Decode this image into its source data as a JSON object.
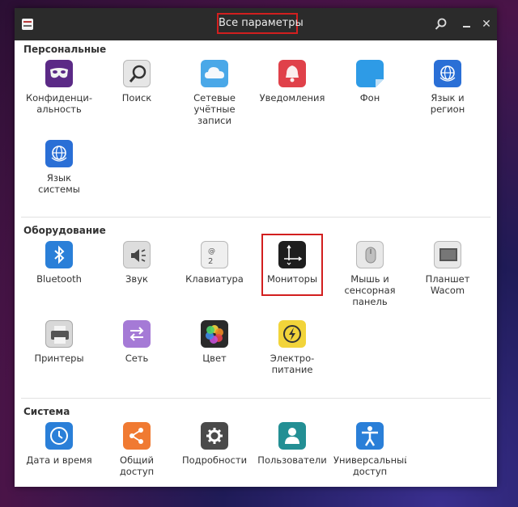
{
  "window": {
    "title": "Все параметры"
  },
  "sections": {
    "personal": "Персональные",
    "hardware": "Оборудование",
    "system": "Система"
  },
  "items": {
    "privacy": "Конфиденци-\nальность",
    "search": "Поиск",
    "online_accounts": "Сетевые\nучётные\nзаписи",
    "notifications": "Уведомления",
    "background": "Фон",
    "language_region": "Язык и\nрегион",
    "system_language": "Язык\nсистемы",
    "bluetooth": "Bluetooth",
    "sound": "Звук",
    "keyboard": "Клавиатура",
    "displays": "Мониторы",
    "mouse_touchpad": "Мышь и\nсенсорная\nпанель",
    "wacom": "Планшет\nWacom",
    "printers": "Принтеры",
    "network": "Сеть",
    "color": "Цвет",
    "power": "Электро-\nпитание",
    "date_time": "Дата и время",
    "sharing": "Общий\nдоступ",
    "details": "Подробности",
    "users": "Пользователи",
    "universal_access": "Универсальный\nдоступ"
  },
  "icons": {
    "privacy": "mask-icon",
    "search": "magnifier-icon",
    "online_accounts": "cloud-icon",
    "notifications": "bell-icon",
    "background": "wallpaper-icon",
    "language_region": "globe-icon",
    "system_language": "globe-icon",
    "bluetooth": "bluetooth-icon",
    "sound": "speaker-icon",
    "keyboard": "keyboard-key-icon",
    "displays": "display-icon",
    "mouse_touchpad": "mouse-icon",
    "wacom": "tablet-icon",
    "printers": "printer-icon",
    "network": "network-arrows-icon",
    "color": "color-wheel-icon",
    "power": "lightning-icon",
    "date_time": "clock-icon",
    "sharing": "share-icon",
    "details": "gear-icon",
    "users": "user-icon",
    "universal_access": "accessibility-icon"
  },
  "colors": {
    "highlight": "#d21f1f",
    "titlebar": "#2b2b2b"
  }
}
